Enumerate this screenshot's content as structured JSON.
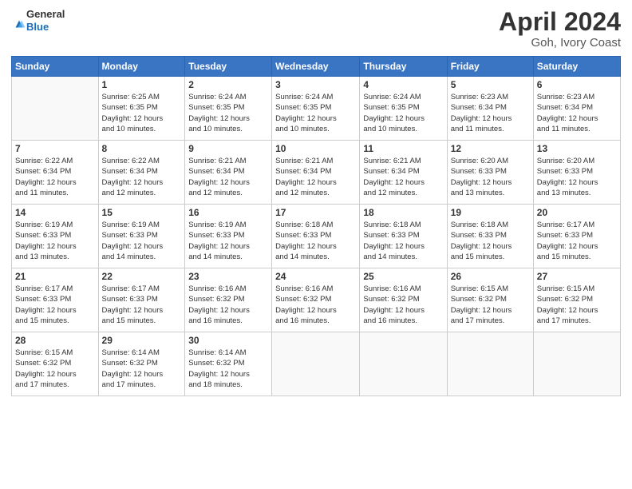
{
  "header": {
    "logo": {
      "part1": "General",
      "part2": "Blue"
    },
    "title": "April 2024",
    "location": "Goh, Ivory Coast"
  },
  "days_of_week": [
    "Sunday",
    "Monday",
    "Tuesday",
    "Wednesday",
    "Thursday",
    "Friday",
    "Saturday"
  ],
  "weeks": [
    [
      {
        "day": "",
        "info": ""
      },
      {
        "day": "1",
        "info": "Sunrise: 6:25 AM\nSunset: 6:35 PM\nDaylight: 12 hours\nand 10 minutes."
      },
      {
        "day": "2",
        "info": "Sunrise: 6:24 AM\nSunset: 6:35 PM\nDaylight: 12 hours\nand 10 minutes."
      },
      {
        "day": "3",
        "info": "Sunrise: 6:24 AM\nSunset: 6:35 PM\nDaylight: 12 hours\nand 10 minutes."
      },
      {
        "day": "4",
        "info": "Sunrise: 6:24 AM\nSunset: 6:35 PM\nDaylight: 12 hours\nand 10 minutes."
      },
      {
        "day": "5",
        "info": "Sunrise: 6:23 AM\nSunset: 6:34 PM\nDaylight: 12 hours\nand 11 minutes."
      },
      {
        "day": "6",
        "info": "Sunrise: 6:23 AM\nSunset: 6:34 PM\nDaylight: 12 hours\nand 11 minutes."
      }
    ],
    [
      {
        "day": "7",
        "info": "Sunrise: 6:22 AM\nSunset: 6:34 PM\nDaylight: 12 hours\nand 11 minutes."
      },
      {
        "day": "8",
        "info": "Sunrise: 6:22 AM\nSunset: 6:34 PM\nDaylight: 12 hours\nand 12 minutes."
      },
      {
        "day": "9",
        "info": "Sunrise: 6:21 AM\nSunset: 6:34 PM\nDaylight: 12 hours\nand 12 minutes."
      },
      {
        "day": "10",
        "info": "Sunrise: 6:21 AM\nSunset: 6:34 PM\nDaylight: 12 hours\nand 12 minutes."
      },
      {
        "day": "11",
        "info": "Sunrise: 6:21 AM\nSunset: 6:34 PM\nDaylight: 12 hours\nand 12 minutes."
      },
      {
        "day": "12",
        "info": "Sunrise: 6:20 AM\nSunset: 6:33 PM\nDaylight: 12 hours\nand 13 minutes."
      },
      {
        "day": "13",
        "info": "Sunrise: 6:20 AM\nSunset: 6:33 PM\nDaylight: 12 hours\nand 13 minutes."
      }
    ],
    [
      {
        "day": "14",
        "info": "Sunrise: 6:19 AM\nSunset: 6:33 PM\nDaylight: 12 hours\nand 13 minutes."
      },
      {
        "day": "15",
        "info": "Sunrise: 6:19 AM\nSunset: 6:33 PM\nDaylight: 12 hours\nand 14 minutes."
      },
      {
        "day": "16",
        "info": "Sunrise: 6:19 AM\nSunset: 6:33 PM\nDaylight: 12 hours\nand 14 minutes."
      },
      {
        "day": "17",
        "info": "Sunrise: 6:18 AM\nSunset: 6:33 PM\nDaylight: 12 hours\nand 14 minutes."
      },
      {
        "day": "18",
        "info": "Sunrise: 6:18 AM\nSunset: 6:33 PM\nDaylight: 12 hours\nand 14 minutes."
      },
      {
        "day": "19",
        "info": "Sunrise: 6:18 AM\nSunset: 6:33 PM\nDaylight: 12 hours\nand 15 minutes."
      },
      {
        "day": "20",
        "info": "Sunrise: 6:17 AM\nSunset: 6:33 PM\nDaylight: 12 hours\nand 15 minutes."
      }
    ],
    [
      {
        "day": "21",
        "info": "Sunrise: 6:17 AM\nSunset: 6:33 PM\nDaylight: 12 hours\nand 15 minutes."
      },
      {
        "day": "22",
        "info": "Sunrise: 6:17 AM\nSunset: 6:33 PM\nDaylight: 12 hours\nand 15 minutes."
      },
      {
        "day": "23",
        "info": "Sunrise: 6:16 AM\nSunset: 6:32 PM\nDaylight: 12 hours\nand 16 minutes."
      },
      {
        "day": "24",
        "info": "Sunrise: 6:16 AM\nSunset: 6:32 PM\nDaylight: 12 hours\nand 16 minutes."
      },
      {
        "day": "25",
        "info": "Sunrise: 6:16 AM\nSunset: 6:32 PM\nDaylight: 12 hours\nand 16 minutes."
      },
      {
        "day": "26",
        "info": "Sunrise: 6:15 AM\nSunset: 6:32 PM\nDaylight: 12 hours\nand 17 minutes."
      },
      {
        "day": "27",
        "info": "Sunrise: 6:15 AM\nSunset: 6:32 PM\nDaylight: 12 hours\nand 17 minutes."
      }
    ],
    [
      {
        "day": "28",
        "info": "Sunrise: 6:15 AM\nSunset: 6:32 PM\nDaylight: 12 hours\nand 17 minutes."
      },
      {
        "day": "29",
        "info": "Sunrise: 6:14 AM\nSunset: 6:32 PM\nDaylight: 12 hours\nand 17 minutes."
      },
      {
        "day": "30",
        "info": "Sunrise: 6:14 AM\nSunset: 6:32 PM\nDaylight: 12 hours\nand 18 minutes."
      },
      {
        "day": "",
        "info": ""
      },
      {
        "day": "",
        "info": ""
      },
      {
        "day": "",
        "info": ""
      },
      {
        "day": "",
        "info": ""
      }
    ]
  ]
}
